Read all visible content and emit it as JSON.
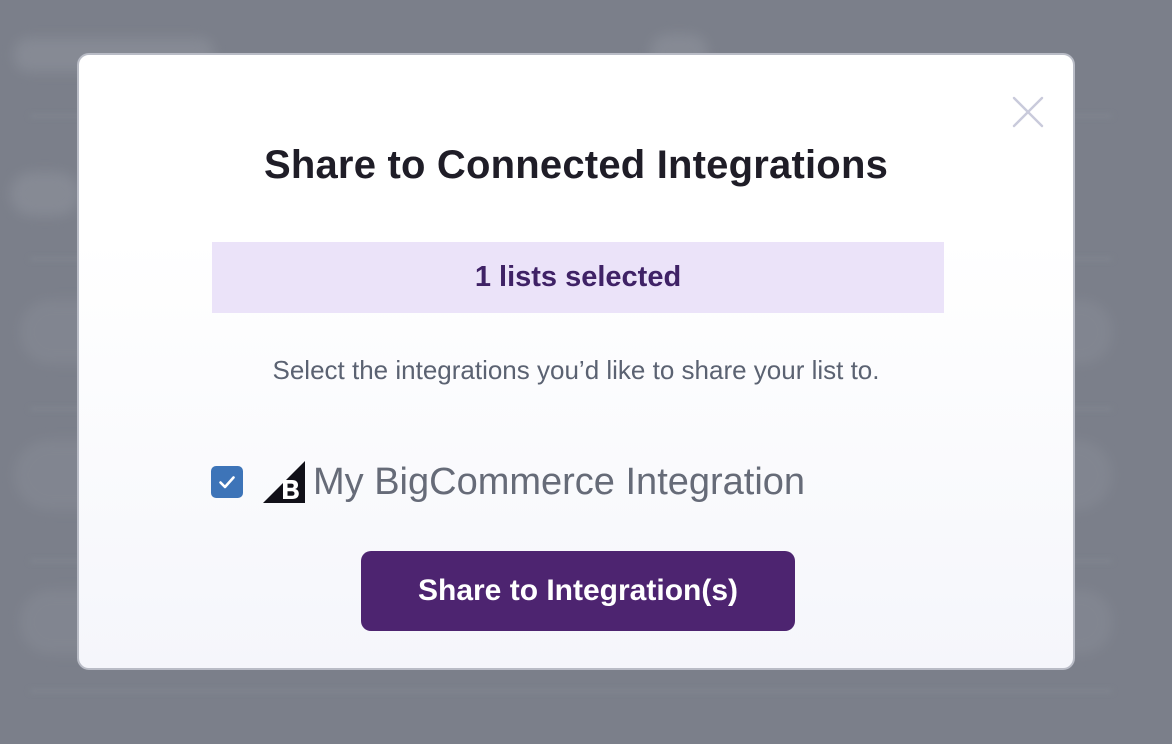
{
  "modal": {
    "title": "Share to Connected Integrations",
    "selected_banner": "1 lists selected",
    "instructions": "Select the integrations you’d like to share your list to.",
    "close_icon": "close-icon"
  },
  "integrations": [
    {
      "label": "My BigCommerce Integration",
      "checked": true,
      "logo_icon": "bigcommerce-logo-icon"
    }
  ],
  "actions": {
    "share_label": "Share to Integration(s)"
  },
  "colors": {
    "backdrop": "#7b7f8a",
    "banner_bg": "#ebe3f9",
    "banner_text": "#3f2266",
    "checkbox": "#3d74b8",
    "primary_button": "#4d2470",
    "title_text": "#1f1d27",
    "muted_text": "#5b6272"
  }
}
